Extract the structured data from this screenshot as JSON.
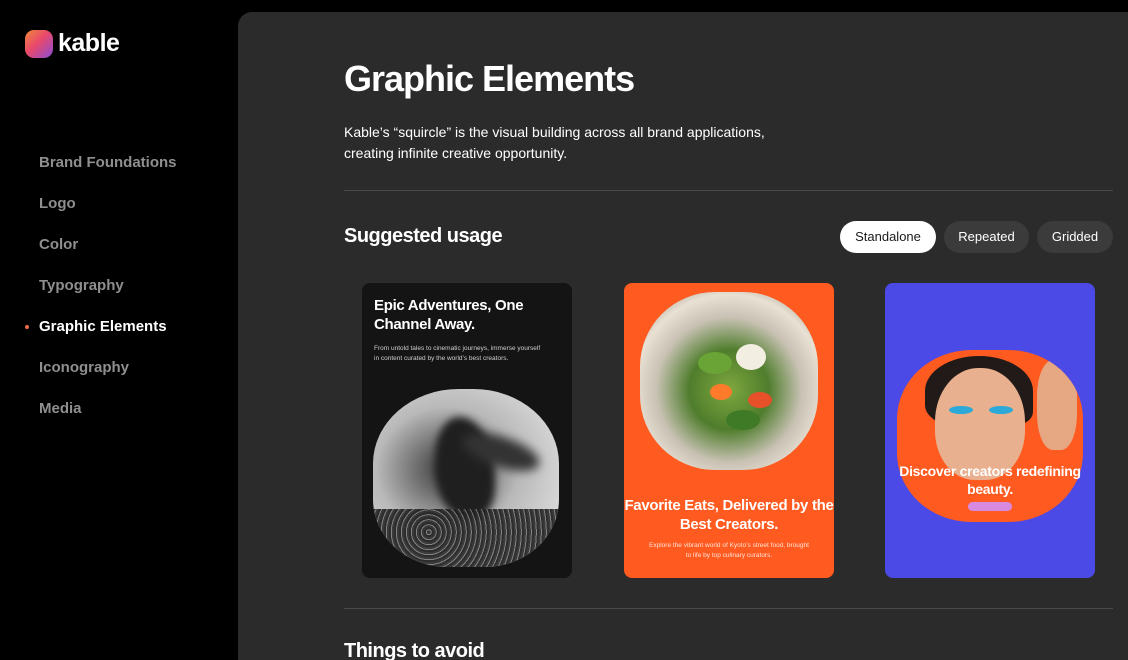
{
  "brand": {
    "name": "kable"
  },
  "sidebar": {
    "items": [
      {
        "label": "Brand Foundations",
        "active": false
      },
      {
        "label": "Logo",
        "active": false
      },
      {
        "label": "Color",
        "active": false
      },
      {
        "label": "Typography",
        "active": false
      },
      {
        "label": "Graphic Elements",
        "active": true
      },
      {
        "label": "Iconography",
        "active": false
      },
      {
        "label": "Media",
        "active": false
      }
    ]
  },
  "main": {
    "title": "Graphic Elements",
    "description": "Kable’s “squircle” is the visual building across all brand applications, creating infinite creative opportunity.",
    "suggested": {
      "title": "Suggested usage",
      "tabs": [
        {
          "label": "Standalone",
          "selected": true
        },
        {
          "label": "Repeated",
          "selected": false
        },
        {
          "label": "Gridded",
          "selected": false
        }
      ],
      "cards": [
        {
          "title": "Epic Adventures, One Channel Away.",
          "body": "From untold tales to cinematic journeys, immerse yourself in content curated by the world’s best creators.",
          "bg_color": "#141414"
        },
        {
          "title": "Favorite Eats, Delivered by the Best Creators.",
          "body": "Explore the vibrant world of Kyoto’s street food, brought to life by top culinary curators.",
          "bg_color": "#ff5a1f"
        },
        {
          "title": "Discover creators redefining beauty.",
          "bg_color": "#4b4ae6"
        }
      ]
    },
    "avoid": {
      "title": "Things to avoid"
    }
  },
  "colors": {
    "accent": "#ef6b47",
    "panel": "#2b2b2b",
    "sidebar": "#000000"
  }
}
